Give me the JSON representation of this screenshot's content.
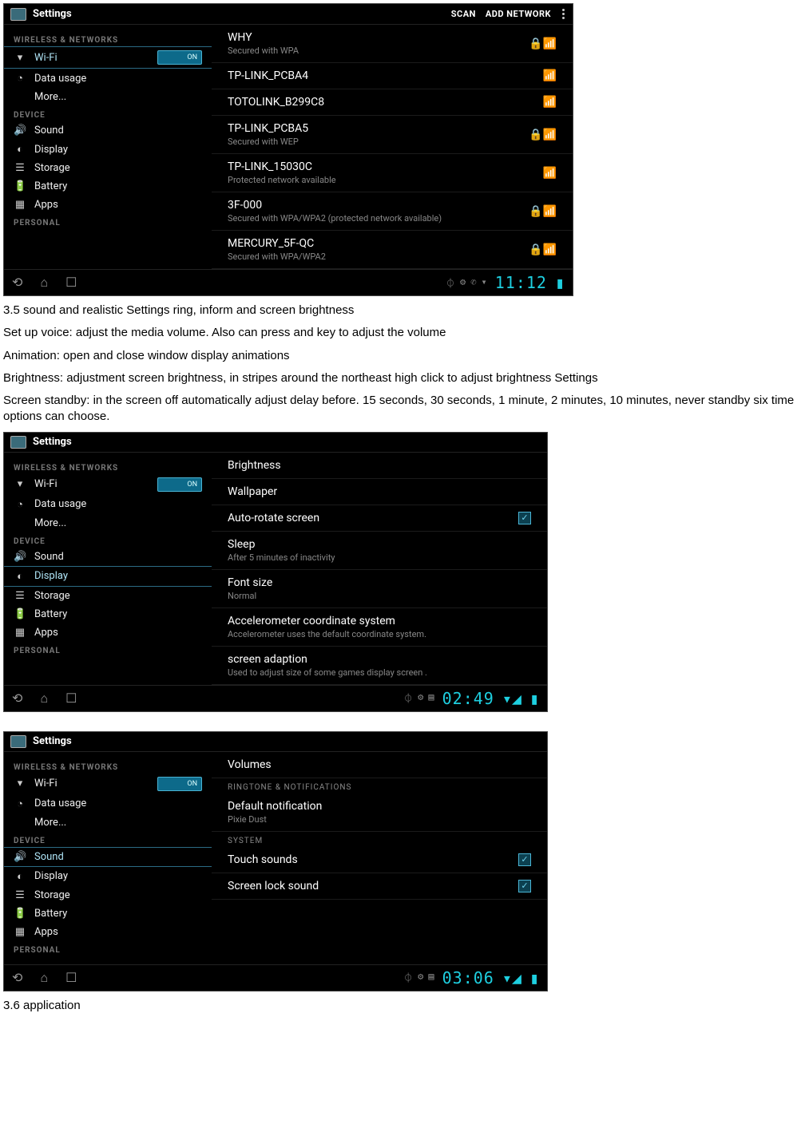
{
  "screenshots": {
    "s1": {
      "title": "Settings",
      "toolbar": {
        "scan": "SCAN",
        "add": "ADD NETWORK"
      },
      "sidebar": {
        "h_wireless": "WIRELESS & NETWORKS",
        "wifi": "Wi-Fi",
        "wifi_toggle": "ON",
        "data": "Data usage",
        "more": "More...",
        "h_device": "DEVICE",
        "sound": "Sound",
        "display": "Display",
        "storage": "Storage",
        "battery": "Battery",
        "apps": "Apps",
        "h_personal": "PERSONAL"
      },
      "networks": [
        {
          "name": "WHY",
          "sub": "Secured with WPA",
          "lock": true
        },
        {
          "name": "TP-LINK_PCBA4",
          "sub": "",
          "lock": false
        },
        {
          "name": "TOTOLINK_B299C8",
          "sub": "",
          "lock": false
        },
        {
          "name": "TP-LINK_PCBA5",
          "sub": "Secured with WEP",
          "lock": true
        },
        {
          "name": "TP-LINK_15030C",
          "sub": "Protected network available",
          "lock": false
        },
        {
          "name": "3F-000",
          "sub": "Secured with WPA/WPA2 (protected network available)",
          "lock": true
        },
        {
          "name": "MERCURY_5F-QC",
          "sub": "Secured with WPA/WPA2",
          "lock": true
        }
      ],
      "time": "11:12"
    },
    "s2": {
      "title": "Settings",
      "sidebar": {
        "h_wireless": "WIRELESS & NETWORKS",
        "wifi": "Wi-Fi",
        "wifi_toggle": "ON",
        "data": "Data usage",
        "more": "More...",
        "h_device": "DEVICE",
        "sound": "Sound",
        "display": "Display",
        "storage": "Storage",
        "battery": "Battery",
        "apps": "Apps",
        "h_personal": "PERSONAL"
      },
      "items": {
        "brightness": "Brightness",
        "wallpaper": "Wallpaper",
        "autorotate": "Auto-rotate screen",
        "sleep": "Sleep",
        "sleep_sub": "After 5 minutes of inactivity",
        "font": "Font size",
        "font_sub": "Normal",
        "accel": "Accelerometer coordinate system",
        "accel_sub": "Accelerometer uses the default coordinate system.",
        "adapt": "screen adaption",
        "adapt_sub": "Used to adjust size of some games display screen ."
      },
      "time": "02:49"
    },
    "s3": {
      "title": "Settings",
      "sidebar": {
        "h_wireless": "WIRELESS & NETWORKS",
        "wifi": "Wi-Fi",
        "wifi_toggle": "ON",
        "data": "Data usage",
        "more": "More...",
        "h_device": "DEVICE",
        "sound": "Sound",
        "display": "Display",
        "storage": "Storage",
        "battery": "Battery",
        "apps": "Apps",
        "h_personal": "PERSONAL"
      },
      "items": {
        "volumes": "Volumes",
        "h_ring": "RINGTONE & NOTIFICATIONS",
        "defnot": "Default notification",
        "defnot_sub": "Pixie Dust",
        "h_sys": "SYSTEM",
        "touch": "Touch sounds",
        "lock": "Screen lock sound"
      },
      "time": "03:06"
    }
  },
  "doc": {
    "p1": "3.5 sound and realistic Settings ring, inform and screen brightness",
    "p2": "Set up voice: adjust the media volume. Also can press and key to adjust the volume",
    "p3": "Animation: open and close window display animations",
    "p4": "Brightness: adjustment screen brightness, in stripes around the northeast high click to adjust brightness Settings",
    "p5": "Screen standby: in the screen off automatically adjust delay before. 15 seconds, 30 seconds, 1 minute, 2 minutes, 10 minutes, never standby six time options can choose.",
    "p6": "3.6 application"
  }
}
